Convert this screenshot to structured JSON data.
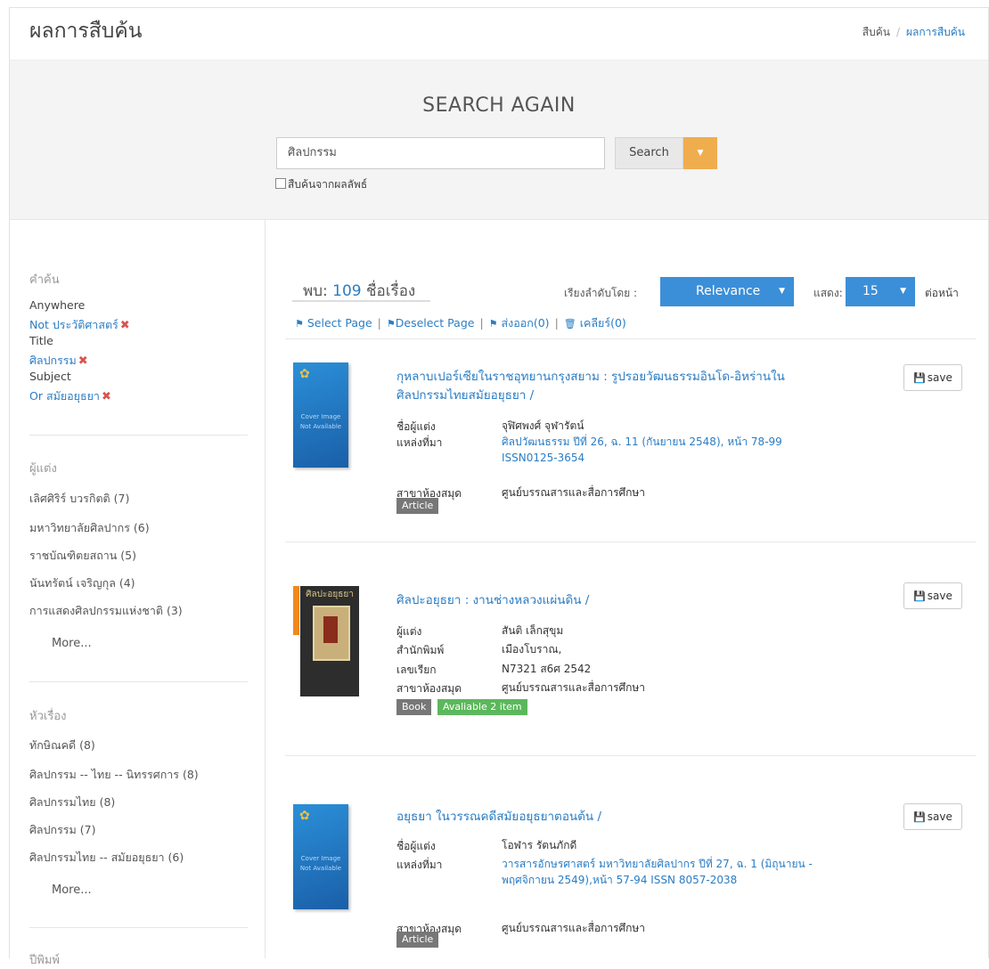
{
  "header": {
    "title": "ผลการสืบค้น",
    "breadcrumb": [
      "สืบค้น",
      "/",
      "ผลการสืบค้น"
    ]
  },
  "search": {
    "heading": "SEARCH AGAIN",
    "query": "ศิลปกรรม",
    "button_label": "Search",
    "within_results_label": "สืบค้นจากผลลัพธ์"
  },
  "sidebar": {
    "keyword_head": "คำค้น",
    "filters": [
      {
        "label": "Anywhere",
        "value": "Not ประวัติศาสตร์"
      },
      {
        "label": "Title",
        "value": "ศิลปกรรม"
      },
      {
        "label": "Subject",
        "value": "Or สมัยอยุธยา"
      }
    ],
    "author_head": "ผู้แต่ง",
    "authors": [
      "เลิศศิริร์ บวรกิตติ (7)",
      "มหาวิทยาลัยศิลปากร (6)",
      "ราชบัณฑิตยสถาน (5)",
      "นันทรัตน์ เจริญกุล (4)",
      "การแสดงศิลปกรรมแห่งชาติ (3)"
    ],
    "subject_head": "หัวเรื่อง",
    "subjects": [
      "ทักษิณคดี (8)",
      "ศิลปกรรม -- ไทย -- นิทรรศการ (8)",
      "ศิลปกรรมไทย (8)",
      "ศิลปกรรม (7)",
      "ศิลปกรรมไทย -- สมัยอยุธยา (6)"
    ],
    "more_label": "More...",
    "year_head": "ปีพิมพ์"
  },
  "results_bar": {
    "found_prefix": "พบ:",
    "found_count": "109",
    "found_suffix": "ชื่อเรื่อง",
    "sort_label": "เรียงลำดับโดย :",
    "sort_value": "Relevance",
    "show_label": "แสดง:",
    "show_value": "15",
    "per_page_label": "ต่อหน้า"
  },
  "actions": {
    "select_page": "Select Page",
    "deselect_page": "Deselect Page",
    "export": "ส่งออก(0)",
    "clear": "เคลียร์(0)"
  },
  "cover_text": "Cover Image\nNot Available",
  "save_label": "save",
  "results": [
    {
      "title": "กุหลาบเปอร์เซียในราชอุทยานกรุงสยาม : รูปรอยวัฒนธรรมอินโด-อิหร่านในศิลปกรรมไทยสมัยอยุธยา /",
      "meta": [
        {
          "label": "ชื่อผู้แต่ง",
          "value": "จุฬิศพงศ์ จุฬารัตน์"
        },
        {
          "label": "แหล่งที่มา",
          "value": "ศิลปวัฒนธรรม ปีที่ 26, ฉ. 11 (กันยายน 2548), หน้า 78-99 ISSN0125-3654"
        },
        {
          "label": "สาขาห้องสมุด",
          "value": "ศูนย์บรรณสารและสื่อการศึกษา"
        }
      ],
      "type": "Article"
    },
    {
      "title": "ศิลปะอยุธยา : งานช่างหลวงแผ่นดิน /",
      "cover_title": "ศิลปะอยุธยา",
      "meta": [
        {
          "label": "ผู้แต่ง",
          "value": "สันติ เล็กสุขุม"
        },
        {
          "label": "สำนักพิมพ์",
          "value": "เมืองโบราณ,"
        },
        {
          "label": "เลขเรียก",
          "value": "N7321 ส6ศ 2542"
        },
        {
          "label": "สาขาห้องสมุด",
          "value": "ศูนย์บรรณสารและสื่อการศึกษา"
        }
      ],
      "type": "Book",
      "availability": "Avaliable 2 item"
    },
    {
      "title": "อยุธยา ในวรรณคดีสมัยอยุธยาตอนต้น /",
      "meta": [
        {
          "label": "ชื่อผู้แต่ง",
          "value": "โอฬาร รัตนภักดี"
        },
        {
          "label": "แหล่งที่มา",
          "value": "วารสารอักษรศาสตร์ มหาวิทยาลัยศิลปากร ปีที่ 27, ฉ. 1 (มิถุนายน - พฤศจิกายน 2549),หน้า 57-94 ISSN 8057-2038"
        },
        {
          "label": "สาขาห้องสมุด",
          "value": "ศูนย์บรรณสารและสื่อการศึกษา"
        }
      ],
      "type": "Article"
    }
  ]
}
